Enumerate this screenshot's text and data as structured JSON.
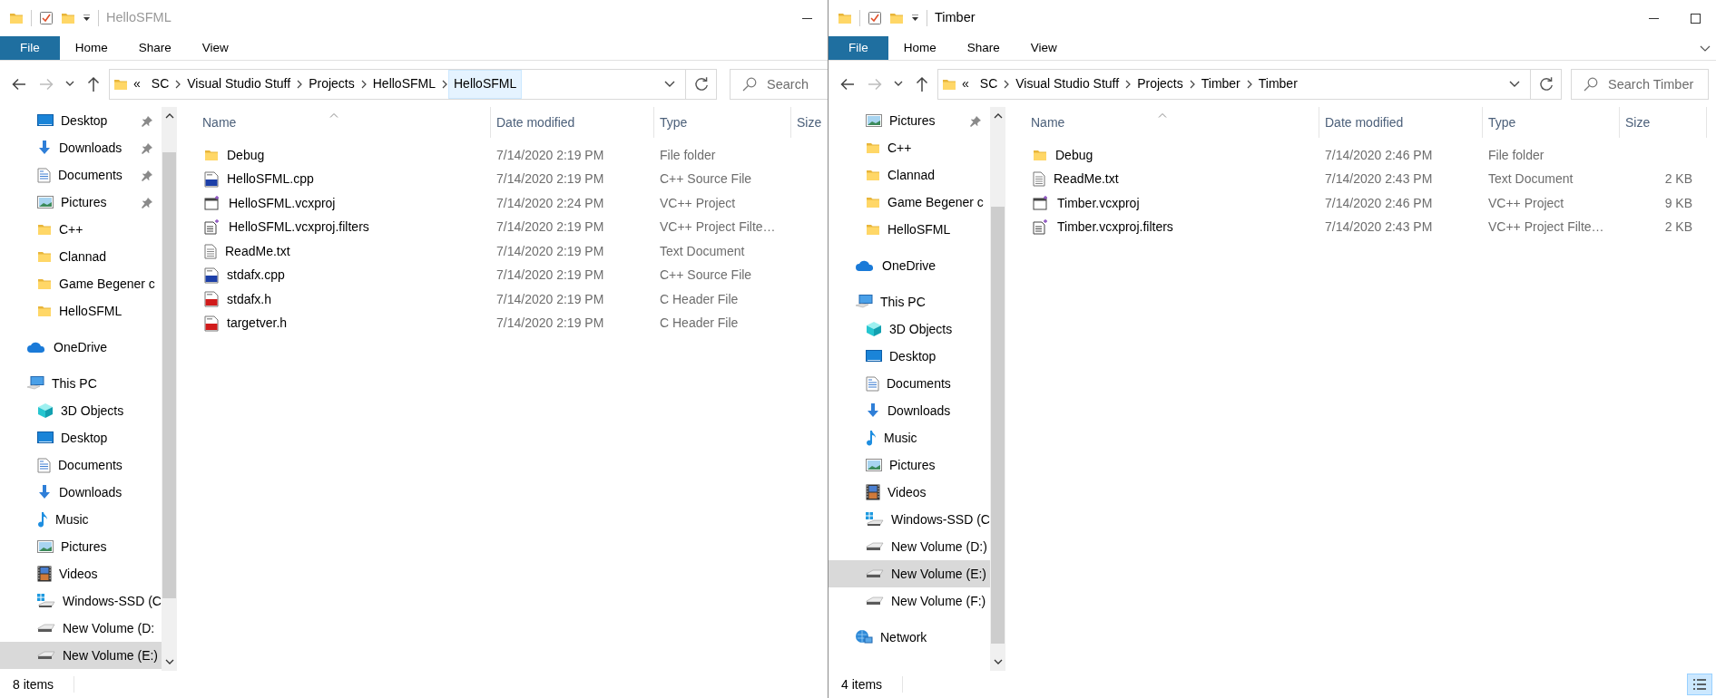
{
  "windows": [
    {
      "active": false,
      "title": "HelloSFML",
      "minimize_button": true,
      "ribbon_tabs": [
        {
          "label": "File",
          "kind": "file"
        },
        {
          "label": "Home",
          "kind": "tab"
        },
        {
          "label": "Share",
          "kind": "tab"
        },
        {
          "label": "View",
          "kind": "tab"
        }
      ],
      "nav_buttons": [
        {
          "kind": "back",
          "disabled": false
        },
        {
          "kind": "forward",
          "disabled": true
        },
        {
          "kind": "recent",
          "disabled": false
        },
        {
          "kind": "up",
          "disabled": false
        }
      ],
      "address": {
        "overflow_mark": "«",
        "crumbs": [
          {
            "label": "SC",
            "highlighted": false
          },
          {
            "label": "Visual Studio Stuff",
            "highlighted": false
          },
          {
            "label": "Projects",
            "highlighted": false
          },
          {
            "label": "HelloSFML",
            "highlighted": false
          },
          {
            "label": "HelloSFML",
            "highlighted": true
          }
        ]
      },
      "search": {
        "placeholder": "Search"
      },
      "sidebar": {
        "quick_access": [
          {
            "label": "Desktop",
            "kind": "desktop",
            "pinned": true,
            "selected": false
          },
          {
            "label": "Downloads",
            "kind": "downloads",
            "pinned": true,
            "selected": false
          },
          {
            "label": "Documents",
            "kind": "documents",
            "pinned": true,
            "selected": false
          },
          {
            "label": "Pictures",
            "kind": "pictures",
            "pinned": true,
            "selected": false
          },
          {
            "label": "C++",
            "kind": "folder",
            "pinned": false,
            "selected": false
          },
          {
            "label": "Clannad",
            "kind": "folder",
            "pinned": false,
            "selected": false
          },
          {
            "label": "Game Begener c",
            "kind": "folder",
            "pinned": false,
            "selected": false
          },
          {
            "label": "HelloSFML",
            "kind": "folder",
            "pinned": false,
            "selected": false
          }
        ],
        "tree": [
          {
            "label": "OneDrive",
            "kind": "onedrive",
            "selected": false
          },
          {
            "label": "This PC",
            "kind": "thispc",
            "selected": false,
            "children": [
              {
                "label": "3D Objects",
                "kind": "objects3d",
                "selected": false
              },
              {
                "label": "Desktop",
                "kind": "desktop",
                "selected": false
              },
              {
                "label": "Documents",
                "kind": "documents",
                "selected": false
              },
              {
                "label": "Downloads",
                "kind": "downloads",
                "selected": false
              },
              {
                "label": "Music",
                "kind": "music",
                "selected": false
              },
              {
                "label": "Pictures",
                "kind": "pictures",
                "selected": false
              },
              {
                "label": "Videos",
                "kind": "videos",
                "selected": false
              },
              {
                "label": "Windows-SSD (C",
                "kind": "windrive",
                "selected": false
              },
              {
                "label": "New Volume (D:",
                "kind": "drive",
                "selected": false
              },
              {
                "label": "New Volume (E:)",
                "kind": "drive",
                "selected": true
              }
            ]
          }
        ]
      },
      "columns": [
        {
          "label": "Name",
          "sorted": true
        },
        {
          "label": "Date modified",
          "sorted": false
        },
        {
          "label": "Type",
          "sorted": false
        },
        {
          "label": "Size",
          "sorted": false
        }
      ],
      "rows": [
        {
          "kind": "folder",
          "name": "Debug",
          "date": "7/14/2020 2:19 PM",
          "type": "File folder"
        },
        {
          "kind": "cpp",
          "name": "HelloSFML.cpp",
          "date": "7/14/2020 2:19 PM",
          "type": "C++ Source File"
        },
        {
          "kind": "vcxproj",
          "name": "HelloSFML.vcxproj",
          "date": "7/14/2020 2:24 PM",
          "type": "VC++ Project"
        },
        {
          "kind": "filters",
          "name": "HelloSFML.vcxproj.filters",
          "date": "7/14/2020 2:19 PM",
          "type": "VC++ Project Filte…"
        },
        {
          "kind": "txt",
          "name": "ReadMe.txt",
          "date": "7/14/2020 2:19 PM",
          "type": "Text Document"
        },
        {
          "kind": "cpp",
          "name": "stdafx.cpp",
          "date": "7/14/2020 2:19 PM",
          "type": "C++ Source File"
        },
        {
          "kind": "h",
          "name": "stdafx.h",
          "date": "7/14/2020 2:19 PM",
          "type": "C Header File"
        },
        {
          "kind": "h",
          "name": "targetver.h",
          "date": "7/14/2020 2:19 PM",
          "type": "C Header File"
        }
      ],
      "status": "8 items"
    },
    {
      "active": true,
      "title": "Timber",
      "minimize_button": true,
      "maximize_button": true,
      "ribbon_expand_button": true,
      "details_view_button": true,
      "ribbon_tabs": [
        {
          "label": "File",
          "kind": "file"
        },
        {
          "label": "Home",
          "kind": "tab"
        },
        {
          "label": "Share",
          "kind": "tab"
        },
        {
          "label": "View",
          "kind": "tab"
        }
      ],
      "nav_buttons": [
        {
          "kind": "back",
          "disabled": false
        },
        {
          "kind": "forward",
          "disabled": true
        },
        {
          "kind": "recent",
          "disabled": false
        },
        {
          "kind": "up",
          "disabled": false
        }
      ],
      "address": {
        "overflow_mark": "«",
        "crumbs": [
          {
            "label": "SC",
            "highlighted": false
          },
          {
            "label": "Visual Studio Stuff",
            "highlighted": false
          },
          {
            "label": "Projects",
            "highlighted": false
          },
          {
            "label": "Timber",
            "highlighted": false
          },
          {
            "label": "Timber",
            "highlighted": false
          }
        ]
      },
      "search": {
        "placeholder": "Search Timber"
      },
      "sidebar": {
        "quick_access": [
          {
            "label": "Pictures",
            "kind": "pictures",
            "pinned": true,
            "selected": false
          },
          {
            "label": "C++",
            "kind": "folder",
            "pinned": false,
            "selected": false
          },
          {
            "label": "Clannad",
            "kind": "folder",
            "pinned": false,
            "selected": false
          },
          {
            "label": "Game Begener c",
            "kind": "folder",
            "pinned": false,
            "selected": false
          },
          {
            "label": "HelloSFML",
            "kind": "folder",
            "pinned": false,
            "selected": false
          }
        ],
        "tree": [
          {
            "label": "OneDrive",
            "kind": "onedrive",
            "selected": false
          },
          {
            "label": "This PC",
            "kind": "thispc",
            "selected": false,
            "children": [
              {
                "label": "3D Objects",
                "kind": "objects3d",
                "selected": false
              },
              {
                "label": "Desktop",
                "kind": "desktop",
                "selected": false
              },
              {
                "label": "Documents",
                "kind": "documents",
                "selected": false
              },
              {
                "label": "Downloads",
                "kind": "downloads",
                "selected": false
              },
              {
                "label": "Music",
                "kind": "music",
                "selected": false
              },
              {
                "label": "Pictures",
                "kind": "pictures",
                "selected": false
              },
              {
                "label": "Videos",
                "kind": "videos",
                "selected": false
              },
              {
                "label": "Windows-SSD (C",
                "kind": "windrive",
                "selected": false
              },
              {
                "label": "New Volume (D:)",
                "kind": "drive",
                "selected": false
              },
              {
                "label": "New Volume (E:)",
                "kind": "drive",
                "selected": true
              },
              {
                "label": "New Volume (F:)",
                "kind": "drive",
                "selected": false
              }
            ]
          },
          {
            "label": "Network",
            "kind": "network",
            "selected": false
          }
        ]
      },
      "columns": [
        {
          "label": "Name",
          "sorted": true
        },
        {
          "label": "Date modified",
          "sorted": false
        },
        {
          "label": "Type",
          "sorted": false
        },
        {
          "label": "Size",
          "sorted": false
        }
      ],
      "rows": [
        {
          "kind": "folder",
          "name": "Debug",
          "date": "7/14/2020 2:46 PM",
          "type": "File folder"
        },
        {
          "kind": "txt",
          "name": "ReadMe.txt",
          "date": "7/14/2020 2:43 PM",
          "type": "Text Document",
          "size": "2 KB"
        },
        {
          "kind": "vcxproj",
          "name": "Timber.vcxproj",
          "date": "7/14/2020 2:46 PM",
          "type": "VC++ Project",
          "size": "9 KB"
        },
        {
          "kind": "filters",
          "name": "Timber.vcxproj.filters",
          "date": "7/14/2020 2:43 PM",
          "type": "VC++ Project Filte…",
          "size": "2 KB"
        }
      ],
      "status": "4 items"
    }
  ]
}
